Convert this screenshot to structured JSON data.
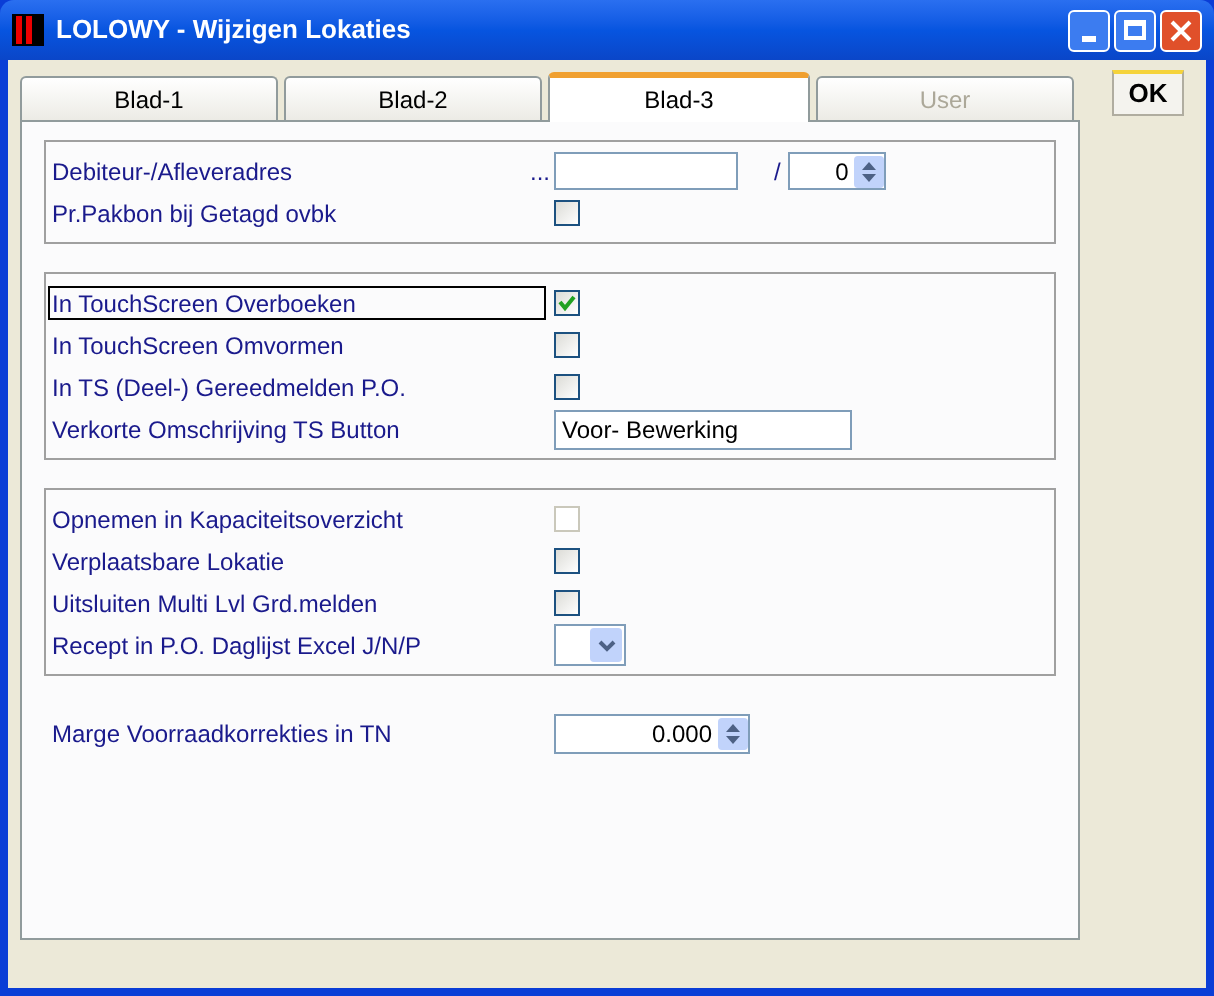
{
  "window": {
    "title": "LOLOWY - Wijzigen Lokaties"
  },
  "tabs": [
    {
      "label": "Blad-1",
      "selected": false,
      "disabled": false
    },
    {
      "label": "Blad-2",
      "selected": false,
      "disabled": false
    },
    {
      "label": "Blad-3",
      "selected": true,
      "disabled": false
    },
    {
      "label": "User",
      "selected": false,
      "disabled": true
    }
  ],
  "ok_button": "OK",
  "groups": [
    {
      "boxed": true,
      "rows": [
        {
          "kind": "lookup",
          "label": "Debiteur-/Afleveradres",
          "lookup": "...",
          "value": "",
          "separator": "/",
          "spin_value": "0",
          "focused": false
        },
        {
          "kind": "checkbox",
          "label": "Pr.Pakbon bij Getagd ovbk",
          "checked": false,
          "disabled": false,
          "focused": false
        }
      ]
    },
    {
      "boxed": true,
      "rows": [
        {
          "kind": "checkbox",
          "label": "In TouchScreen Overboeken",
          "checked": true,
          "disabled": false,
          "focused": true
        },
        {
          "kind": "checkbox",
          "label": "In TouchScreen Omvormen",
          "checked": false,
          "disabled": false,
          "focused": false
        },
        {
          "kind": "checkbox",
          "label": "In TS (Deel-) Gereedmelden P.O.",
          "checked": false,
          "disabled": false,
          "focused": false
        },
        {
          "kind": "text",
          "label": "Verkorte Omschrijving TS Button",
          "value": "Voor- Bewerking",
          "focused": false
        }
      ]
    },
    {
      "boxed": true,
      "rows": [
        {
          "kind": "checkbox",
          "label": "Opnemen in Kapaciteitsoverzicht",
          "checked": false,
          "disabled": true,
          "focused": false
        },
        {
          "kind": "checkbox",
          "label": "Verplaatsbare Lokatie",
          "checked": false,
          "disabled": false,
          "focused": false
        },
        {
          "kind": "checkbox",
          "label": "Uitsluiten Multi Lvl Grd.melden",
          "checked": false,
          "disabled": false,
          "focused": false
        },
        {
          "kind": "combo",
          "label": "Recept in P.O. Daglijst Excel J/N/P",
          "focused": false
        }
      ]
    },
    {
      "boxed": false,
      "rows": [
        {
          "kind": "spin",
          "label": "Marge Voorraadkorrekties in TN",
          "value": "0.000",
          "focused": false
        }
      ]
    }
  ]
}
